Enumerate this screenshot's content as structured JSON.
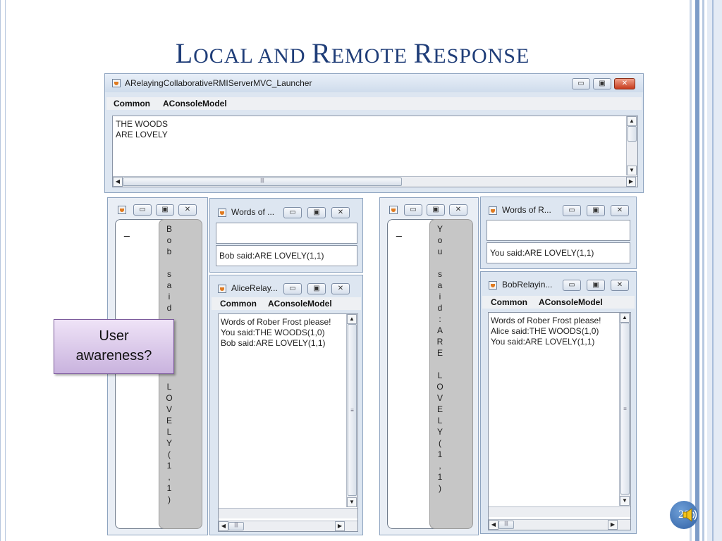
{
  "slide": {
    "title_parts": [
      "L",
      "OCAL AND ",
      "R",
      "EMOTE ",
      "R",
      "ESPONSE"
    ],
    "callout_line1": "User",
    "callout_line2": "awareness?",
    "page_number": "20",
    "colors": {
      "title": "#1f3d78",
      "callout_border": "#7b5a9b",
      "page_circle": "#2f5fa3"
    }
  },
  "server_window": {
    "title": "ARelayingCollaborativeRMIServerMVC_Launcher",
    "menu": [
      "Common",
      "AConsoleModel"
    ],
    "lines": [
      "THE WOODS",
      "ARE LOVELY"
    ],
    "hscroll_grip": "|||"
  },
  "alice": {
    "compact_chars": [
      "B",
      "o",
      "b",
      "",
      "s",
      "a",
      "i",
      "d",
      "",
      "",
      "",
      "",
      "",
      "",
      "L",
      "O",
      "V",
      "E",
      "L",
      "Y",
      "(",
      "1",
      ",",
      "1",
      ")"
    ],
    "input_cursor": "_",
    "words_window": {
      "title": "Words of ...",
      "status": "Bob said:ARE LOVELY(1,1)"
    },
    "console_window": {
      "title": "AliceRelay...",
      "menu": [
        "Common",
        "AConsoleModel"
      ],
      "lines": [
        "Words of Rober Frost please!",
        "You said:THE WOODS(1,0)",
        "Bob said:ARE LOVELY(1,1)"
      ],
      "hscroll_grip": "|||"
    }
  },
  "bob": {
    "compact_chars": [
      "Y",
      "o",
      "u",
      "",
      "s",
      "a",
      "i",
      "d",
      ":",
      "A",
      "R",
      "E",
      "",
      "L",
      "O",
      "V",
      "E",
      "L",
      "Y",
      "(",
      "1",
      ",",
      "1",
      ")"
    ],
    "input_cursor": "_",
    "words_window": {
      "title": "Words of R...",
      "status": "You said:ARE LOVELY(1,1)"
    },
    "console_window": {
      "title": "BobRelayin...",
      "menu": [
        "Common",
        "AConsoleModel"
      ],
      "lines": [
        "Words of Rober Frost please!",
        "Alice said:THE WOODS(1,0)",
        "You said:ARE LOVELY(1,1)"
      ],
      "hscroll_grip": "|||"
    }
  }
}
